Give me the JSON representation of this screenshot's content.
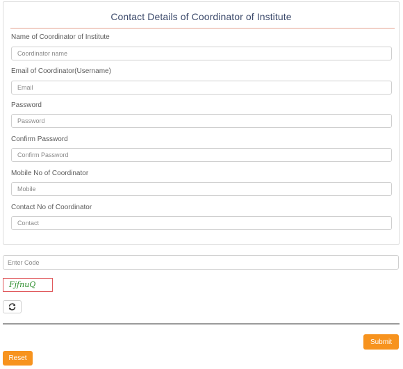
{
  "form": {
    "title": "Contact Details of Coordinator of Institute",
    "fields": [
      {
        "label": "Name of Coordinator of Institute",
        "placeholder": "Coordinator name",
        "value": ""
      },
      {
        "label": "Email of Coordinator(Username)",
        "placeholder": "Email",
        "value": ""
      },
      {
        "label": "Password",
        "placeholder": "Password",
        "value": ""
      },
      {
        "label": "Confirm Password",
        "placeholder": "Confirm Password",
        "value": ""
      },
      {
        "label": "Mobile No of Coordinator",
        "placeholder": "Mobile",
        "value": ""
      },
      {
        "label": "Contact No of Coordinator",
        "placeholder": "Contact",
        "value": ""
      }
    ]
  },
  "captcha": {
    "input_placeholder": "Enter Code",
    "code": "FjfnuQ",
    "refresh_icon": "refresh-icon"
  },
  "actions": {
    "submit_label": "Submit",
    "reset_label": "Reset"
  },
  "colors": {
    "accent": "#f7931e",
    "title_rule": "#e3a08e",
    "captcha_border": "#e0595c",
    "captcha_text": "#2e8f2e"
  }
}
